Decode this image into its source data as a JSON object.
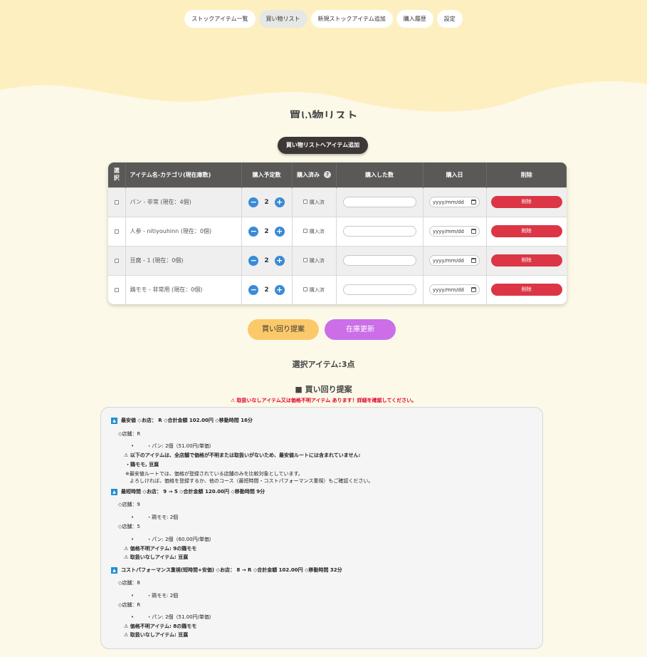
{
  "nav": {
    "tabs": [
      {
        "label": "ストックアイテム一覧",
        "active": false
      },
      {
        "label": "買い物リスト",
        "active": true
      },
      {
        "label": "新規ストックアイテム追加",
        "active": false
      },
      {
        "label": "購入履歴",
        "active": false
      },
      {
        "label": "設定",
        "active": false
      }
    ]
  },
  "page": {
    "title": "買い物リスト",
    "add_button": "買い物リストへアイテム追加"
  },
  "table": {
    "headers": {
      "select": "選択",
      "name": "アイテム名-カテゴリ(現在庫数)",
      "planned": "購入予定数",
      "purchased": "購入済み",
      "bought_qty": "購入した数",
      "date": "購入日",
      "delete": "削除"
    },
    "purchased_hint": "?",
    "rows": [
      {
        "name": "パン - 非常 (現在：4個)",
        "qty": "2",
        "purchased_label": "購入済",
        "date_placeholder": "yyyy/mm/dd",
        "delete_label": "削除"
      },
      {
        "name": "人参 - nitiyouhinn (現在：0個)",
        "qty": "2",
        "purchased_label": "購入済",
        "date_placeholder": "yyyy/mm/dd",
        "delete_label": "削除"
      },
      {
        "name": "豆腐 - 1 (現在：0個)",
        "qty": "2",
        "purchased_label": "購入済",
        "date_placeholder": "yyyy/mm/dd",
        "delete_label": "削除"
      },
      {
        "name": "鶏モモ - 非常用 (現在：0個)",
        "qty": "2",
        "purchased_label": "購入済",
        "date_placeholder": "yyyy/mm/dd",
        "delete_label": "削除"
      }
    ],
    "minus": "−",
    "plus": "+"
  },
  "actions": {
    "route_button": "買い回り提案",
    "stock_button": "在庫更新"
  },
  "selected_text": "選択アイテム:3点",
  "route": {
    "title": "■ 買い回り提案",
    "warning": "⚠ 取扱いなしアイテム又は価格不明アイテム あります！詳細を確認してください。",
    "tri": "▲",
    "cheapest": {
      "header": "最安値 ◇お店： R ◇合計金額 102.00円 ◇移動時間 16分",
      "store": "◇店舗：R",
      "item": "・パン: 2個（51.00円/単価）",
      "note1": "⚠ 以下のアイテムは、全店舗で価格が不明または取扱いがないため、最安値ルートには含まれていません:",
      "note2": "・鶏モモ, 豆腐",
      "note3": "※最安値ルートでは、価格が登録されている店舗のみを比較対象としています。",
      "note4": "よろしければ、価格を登録するか、他のコース（最短時間・コストパフォーマンス重視）もご確認ください。"
    },
    "fastest": {
      "header": "最短時間 ◇お店： 9 → 5 ◇合計金額 120.00円 ◇移動時間 9分",
      "store1": "◇店舗：9",
      "item1": "・鶏モモ: 2個",
      "store2": "◇店舗：5",
      "item2": "・パン: 2個（60.00円/単価）",
      "warn1": "⚠ 価格不明アイテム: 9の鶏モモ",
      "warn2": "⚠ 取扱いなしアイテム: 豆腐"
    },
    "costperf": {
      "header": "コストパフォーマンス重視(短時間+安価) ◇お店： 8 → R ◇合計金額 102.00円 ◇移動時間 32分",
      "store1": "◇店舗：8",
      "item1": "・鶏モモ: 2個",
      "store2": "◇店舗：R",
      "item2": "・パン: 2個（51.00円/単価）",
      "warn1": "⚠ 価格不明アイテム: 8の鶏モモ",
      "warn2": "⚠ 取扱いなしアイテム: 豆腐"
    },
    "dot": "•"
  },
  "colors": {
    "hero": "#fdefbf",
    "background": "#fdf9e9",
    "accent_blue": "#3a8bd6",
    "danger": "#dc3545",
    "route_button": "#fcc96a",
    "stock_button": "#cb6ee8"
  }
}
